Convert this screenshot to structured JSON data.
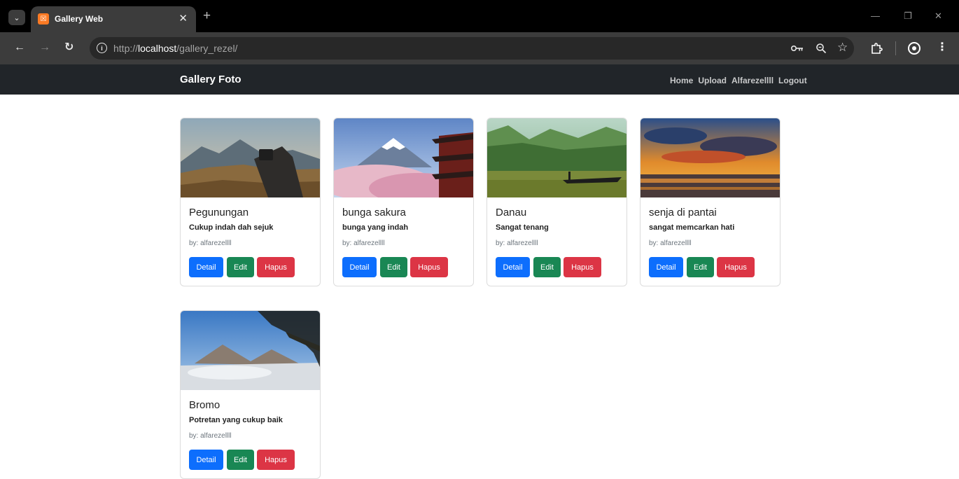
{
  "browser": {
    "tab_title": "Gallery Web",
    "favicon_glyph": "☒",
    "url_prefix": "http://",
    "url_host": "localhost",
    "url_path": "/gallery_rezel/"
  },
  "navbar": {
    "brand": "Gallery Foto",
    "links": [
      "Home",
      "Upload",
      "Alfarezellll",
      "Logout"
    ]
  },
  "buttons": {
    "detail": "Detail",
    "edit": "Edit",
    "hapus": "Hapus"
  },
  "photos": [
    {
      "title": "Pegunungan",
      "description": "Cukup indah dah sejuk",
      "author": "by: alfarezellll",
      "image": "mountain-hand-phone-photo"
    },
    {
      "title": "bunga sakura",
      "description": "bunga yang indah",
      "author": "by: alfarezellll",
      "image": "fuji-sakura-pagoda-photo"
    },
    {
      "title": "Danau",
      "description": "Sangat tenang",
      "author": "by: alfarezellll",
      "image": "lake-boat-photo"
    },
    {
      "title": "senja di pantai",
      "description": "sangat memcarkan hati",
      "author": "by: alfarezellll",
      "image": "beach-sunset-photo"
    },
    {
      "title": "Bromo",
      "description": "Potretan yang cukup baik",
      "author": "by: alfarezellll",
      "image": "bromo-volcano-photo"
    }
  ],
  "colors": {
    "navbar_bg": "#212529",
    "detail": "#0d6efd",
    "edit": "#198754",
    "hapus": "#dc3545"
  }
}
